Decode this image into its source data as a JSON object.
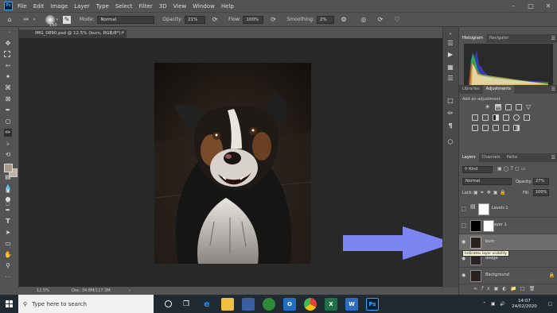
{
  "menubar": {
    "logo": "Ps",
    "items": [
      "File",
      "Edit",
      "Image",
      "Layer",
      "Type",
      "Select",
      "Filter",
      "3D",
      "View",
      "Window",
      "Help"
    ]
  },
  "options": {
    "brush_size": "150",
    "mode_label": "Mode:",
    "mode_value": "Normal",
    "opacity_label": "Opacity:",
    "opacity_value": "21%",
    "flow_label": "Flow:",
    "flow_value": "100%",
    "smoothing_label": "Smoothing:",
    "smoothing_value": "2%"
  },
  "document": {
    "tab_title": "IMG_0890.psd @ 12.5% (burn, RGB/8*) *",
    "zoom": "12.5%",
    "doc_size": "Doc: 34.8M/117.3M"
  },
  "histogram_panel": {
    "tabs": [
      "Histogram",
      "Navigator"
    ]
  },
  "adjustments_panel": {
    "tabs": [
      "Libraries",
      "Adjustments"
    ],
    "hint": "Add an adjustment"
  },
  "layers_panel": {
    "tabs": [
      "Layers",
      "Channels",
      "Paths"
    ],
    "kind_label": "Kind",
    "blend_mode": "Normal",
    "opacity_label": "Opacity:",
    "opacity_value": "27%",
    "lock_label": "Lock:",
    "fill_label": "Fill:",
    "fill_value": "100%",
    "layers": [
      {
        "name": "Levels 1",
        "visible": false
      },
      {
        "name": "Layer 1",
        "visible": false
      },
      {
        "name": "burn",
        "visible": true,
        "selected": true
      },
      {
        "name": "dodge",
        "visible": true
      },
      {
        "name": "Background",
        "visible": true
      }
    ],
    "tooltip": "Indicates layer visibility"
  },
  "annotation": {
    "arrow_color": "#7b86f2"
  },
  "taskbar": {
    "search_placeholder": "Type here to search",
    "time": "14:07",
    "date": "24/02/2020"
  }
}
